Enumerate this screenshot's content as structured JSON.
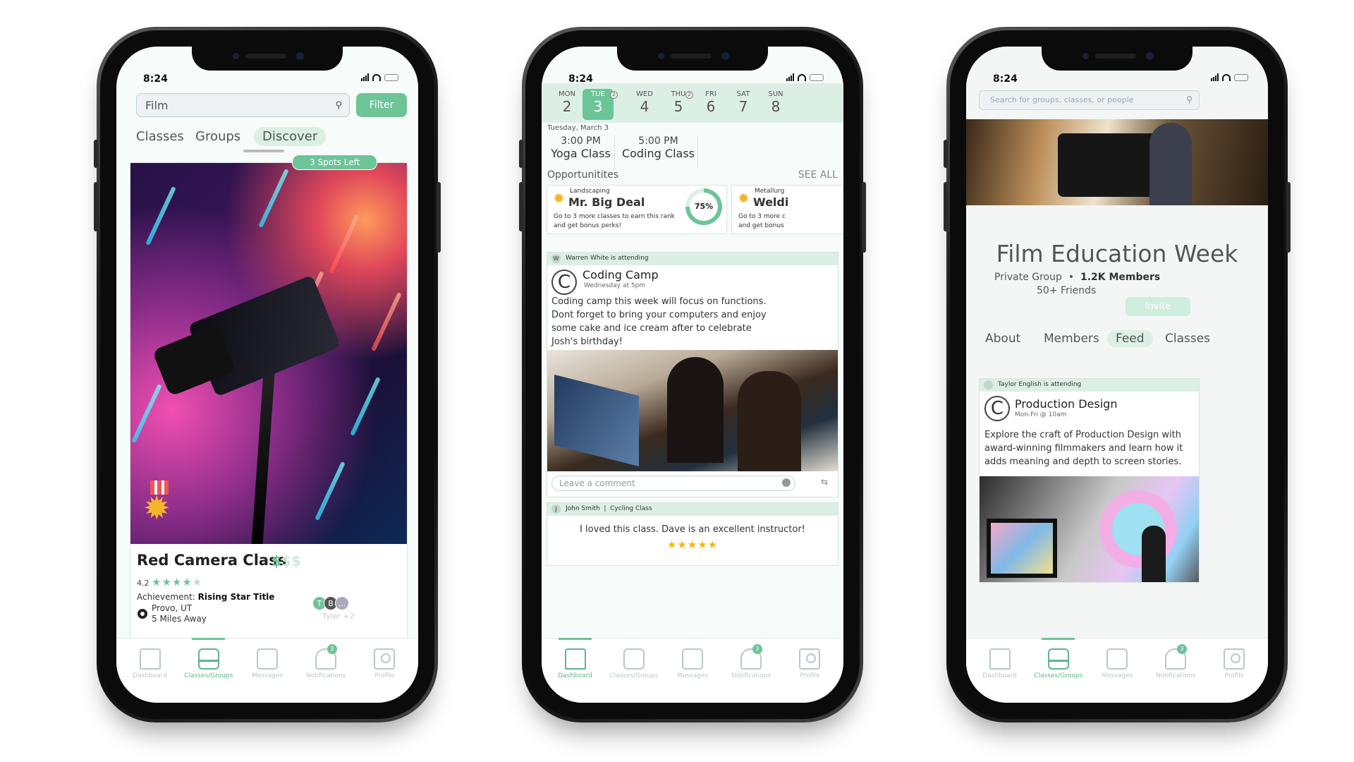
{
  "phones": [
    {
      "status_time": "8:24",
      "search": {
        "value": "Film"
      },
      "filter_label": "Filter",
      "segments": [
        "Classes",
        "Groups",
        "Discover"
      ],
      "active_segment": "Discover",
      "card": {
        "badge": "3 Spots Left",
        "title": "Red Camera Class",
        "price_active": "$",
        "price_inactive": "$$",
        "rating": "4.2",
        "stars_filled": 4,
        "stars_total": 5,
        "achievement_label": "Achievement:",
        "achievement_value": "Rising Star Title",
        "location": "Provo, UT",
        "distance": "5 Miles Away",
        "attendee_initials": [
          "T",
          "B",
          "..."
        ],
        "attendee_note": "Tyler +2"
      },
      "active_tab": "Classes/Groups"
    },
    {
      "status_time": "8:24",
      "week": [
        {
          "name": "MON",
          "date": "2"
        },
        {
          "name": "TUE",
          "date": "3",
          "badge": "2"
        },
        {
          "name": "WED",
          "date": "4"
        },
        {
          "name": "THU",
          "date": "5",
          "badge": "2"
        },
        {
          "name": "FRI",
          "date": "6"
        },
        {
          "name": "SAT",
          "date": "7"
        },
        {
          "name": "SUN",
          "date": "8"
        }
      ],
      "selected_day": "TUE",
      "date_label": "Tuesday, March 3",
      "schedule": [
        {
          "time": "3:00 PM",
          "name": "Yoga Class"
        },
        {
          "time": "5:00 PM",
          "name": "Coding Class"
        }
      ],
      "opportunities": {
        "header": "Opportunitites",
        "see_all": "SEE ALL",
        "items": [
          {
            "category": "Landscaping",
            "rank": "Mr. Big Deal",
            "desc_line1": "Go to 3 more classes to earn this rank",
            "desc_line2": "and get bonus perks!",
            "progress": "75%"
          },
          {
            "category": "Metallurg",
            "rank": "Weldi",
            "desc_line1": "Go to 3 more c",
            "desc_line2": "and get bonus"
          }
        ]
      },
      "post": {
        "attending": "Warren White is attending",
        "attending_initial": "W",
        "icon_letter": "C",
        "title": "Coding Camp",
        "subtitle": "Wednesday at 5pm",
        "body": "Coding camp this week will focus on functions. Dont forget to bring your computers and enjoy some cake and ice cream after to celebrate Josh's birthday!",
        "comment_placeholder": "Leave a comment"
      },
      "review": {
        "author_initial": "J",
        "author": "John Smith",
        "class": "Cycling Class",
        "text": "I loved this class. Dave is an excellent instructor!",
        "stars": "★★★★★"
      },
      "active_tab": "Dashboard"
    },
    {
      "status_time": "8:24",
      "search_placeholder": "Search for groups, classes, or people",
      "group": {
        "title": "Film Education Week",
        "privacy": "Private Group",
        "members": "1.2K Members",
        "friends": "50+ Friends",
        "invite_label": "Invite"
      },
      "tabs": [
        "About",
        "Members",
        "Feed",
        "Classes"
      ],
      "active_group_tab": "Feed",
      "post": {
        "attending": "Taylor English is attending",
        "icon_letter": "C",
        "title": "Production Design",
        "subtitle": "Mon-Fri @ 10am",
        "body": "Explore the craft of Production Design with award-winning filmmakers and learn how it adds meaning and depth to screen stories."
      },
      "active_tab": "Classes/Groups"
    }
  ],
  "tabbar": [
    {
      "label": "Dashboard",
      "icon": "home-icon"
    },
    {
      "label": "Classes/Groups",
      "icon": "classes-icon"
    },
    {
      "label": "Messages",
      "icon": "messages-icon"
    },
    {
      "label": "Notifications",
      "icon": "bell-icon",
      "badge": "3"
    },
    {
      "label": "Profile",
      "icon": "profile-icon"
    }
  ],
  "colors": {
    "accent": "#6cc497",
    "accent_light": "#dcefe5",
    "star": "#f0b90b"
  }
}
